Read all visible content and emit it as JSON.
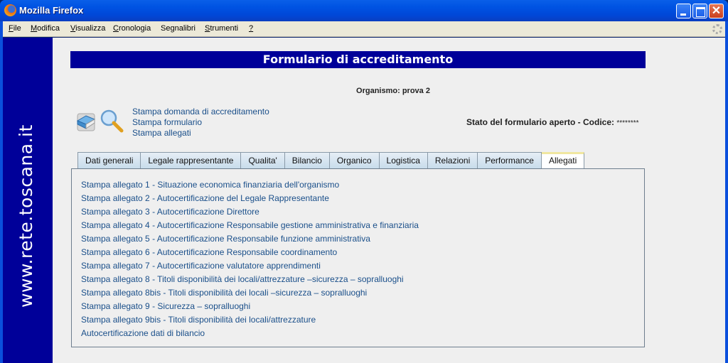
{
  "window": {
    "title": "Mozilla Firefox",
    "controls": [
      "minimize",
      "maximize",
      "close"
    ]
  },
  "menubar": {
    "items": [
      {
        "label": "File",
        "accel": "F"
      },
      {
        "label": "Modifica",
        "accel": "M"
      },
      {
        "label": "Visualizza",
        "accel": "V"
      },
      {
        "label": "Cronologia",
        "accel": "C"
      },
      {
        "label": "Segnalibri",
        "accel": "g"
      },
      {
        "label": "Strumenti",
        "accel": "S"
      },
      {
        "label": "?",
        "accel": "?"
      }
    ]
  },
  "sidebar": {
    "text": "www.rete.toscana.it"
  },
  "page": {
    "title": "Formulario di accreditamento",
    "organismo": "Organismo: prova 2",
    "print_links": [
      "Stampa domanda di accreditamento",
      "Stampa formulario",
      "Stampa allegati"
    ],
    "stato_label": "Stato del formulario aperto - Codice:",
    "stato_code": "********"
  },
  "tabs": [
    {
      "label": "Dati generali",
      "active": false
    },
    {
      "label": "Legale rappresentante",
      "active": false
    },
    {
      "label": "Qualita'",
      "active": false
    },
    {
      "label": "Bilancio",
      "active": false
    },
    {
      "label": "Organico",
      "active": false
    },
    {
      "label": "Logistica",
      "active": false
    },
    {
      "label": "Relazioni",
      "active": false
    },
    {
      "label": "Performance",
      "active": false
    },
    {
      "label": "Allegati",
      "active": true
    }
  ],
  "allegati": [
    "Stampa allegato 1 - Situazione economica finanziaria dell'organismo",
    "Stampa allegato 2 - Autocertificazione del Legale Rappresentante",
    "Stampa allegato 3 - Autocertificazione Direttore",
    "Stampa allegato 4 - Autocertificazione Responsabile gestione amministrativa e finanziaria",
    "Stampa allegato 5 - Autocertificazione Responsabile funzione amministrativa",
    "Stampa allegato 6 - Autocertificazione Responsabile coordinamento",
    "Stampa allegato 7 - Autocertificazione valutatore apprendimenti",
    "Stampa allegato 8 - Titoli disponibilità dei locali/attrezzature –sicurezza – sopralluoghi",
    "Stampa allegato 8bis - Titoli disponibilità dei locali –sicurezza – sopralluoghi",
    "Stampa allegato 9 - Sicurezza – sopralluoghi",
    "Stampa allegato 9bis - Titoli disponibilità dei locali/attrezzature",
    "Autocertificazione dati di bilancio"
  ],
  "colors": {
    "brand_blue": "#000099",
    "link": "#1a4f8a",
    "active_tab_accent": "#f0e7a0"
  }
}
